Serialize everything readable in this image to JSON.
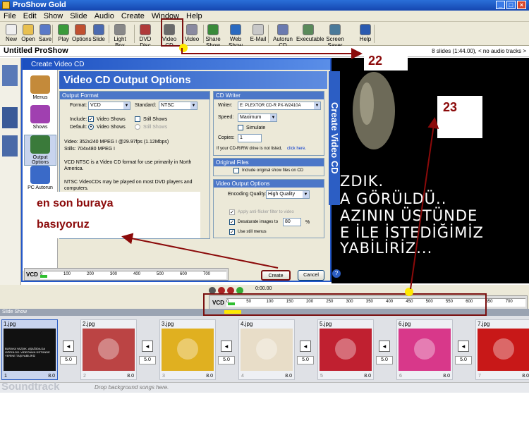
{
  "app": {
    "title": "ProShow Gold"
  },
  "menu": [
    "File",
    "Edit",
    "Show",
    "Slide",
    "Audio",
    "Create",
    "Window",
    "Help"
  ],
  "toolbar": [
    {
      "label": "New",
      "icon": "new-icon"
    },
    {
      "label": "Open",
      "icon": "open-icon"
    },
    {
      "label": "Save",
      "icon": "save-icon"
    },
    {
      "label": "Play",
      "icon": "play-icon"
    },
    {
      "label": "Options",
      "icon": "options-icon"
    },
    {
      "label": "Slide",
      "icon": "slide-icon"
    },
    {
      "label": "Light Box",
      "icon": "lightbox-icon"
    },
    {
      "label": "DVD Disc",
      "icon": "dvd-icon"
    },
    {
      "label": "Video CD",
      "icon": "videocd-icon"
    },
    {
      "label": "Video",
      "icon": "video-icon"
    },
    {
      "label": "Share Show",
      "icon": "share-icon"
    },
    {
      "label": "Web Show",
      "icon": "web-icon"
    },
    {
      "label": "E-Mail",
      "icon": "email-icon"
    },
    {
      "label": "Autorun CD",
      "icon": "autorun-icon"
    },
    {
      "label": "Executable",
      "icon": "executable-icon"
    },
    {
      "label": "Screen Saver",
      "icon": "screensaver-icon"
    },
    {
      "label": "Help",
      "icon": "help-icon"
    }
  ],
  "show": {
    "title": "Untitled ProShow",
    "info": "8 slides (1:44.00), < no audio tracks >"
  },
  "dialog": {
    "window_title": "Create Video CD",
    "header": "Video CD Output Options",
    "side_label": "Create Video CD",
    "sidebar": [
      "Menus",
      "Shows",
      "Output Options",
      "PC Autorun"
    ],
    "output_format": {
      "heading": "Output Format",
      "format_label": "Format:",
      "format_value": "VCD",
      "standard_label": "Standard:",
      "standard_value": "NTSC",
      "include_label": "Include:",
      "include_video": "Video Shows",
      "include_still": "Still Shows",
      "default_label": "Default:",
      "default_video": "Video Shows",
      "default_still": "Still Shows",
      "info_video": "Video: 352x240 MPEG I @29.97fps (1.12Mbps)",
      "info_stills": "Stills: 704x480 MPEG I",
      "desc1": "VCD NTSC is a Video CD format for use primarily in North America.",
      "desc2": "NTSC VideoCDs may be played on most DVD players and computers."
    },
    "cd_writer": {
      "heading": "CD Writer",
      "writer_label": "Writer:",
      "writer_value": "E: PLEXTOR CD-R   PX-W2410A",
      "speed_label": "Speed:",
      "speed_value": "Maximum",
      "simulate": "Simulate",
      "copies_label": "Copies:",
      "copies_value": "1",
      "note": "If your CD-R/RW drive is not listed,",
      "note_link": "click here."
    },
    "original_files": {
      "heading": "Original Files",
      "option": "Include original show files on CD"
    },
    "video_output": {
      "heading": "Video Output Options",
      "quality_label": "Encoding Quality:",
      "quality_value": "High Quality",
      "antiflicker": "Apply anti-flicker filter to video",
      "desaturate": "Desaturate images to",
      "desaturate_value": "80",
      "desaturate_unit": "%",
      "still_menus": "Use still menus"
    },
    "vcd_label": "VCD",
    "ruler_ticks": [
      "0",
      "100",
      "200",
      "300",
      "400",
      "500",
      "600",
      "700"
    ],
    "create": "Create",
    "cancel": "Cancel"
  },
  "preview_text": [
    "ZDIK.",
    "A GÖRÜLDÜ..",
    "AZININ ÜSTÜNDE",
    "E İLE İSTEDİĞİMİZ",
    "YABİLİRİZ..."
  ],
  "timeline": {
    "time": "0:00.00",
    "vcd_label": "VCD",
    "ticks": [
      "0",
      "50",
      "100",
      "150",
      "200",
      "250",
      "300",
      "350",
      "400",
      "450",
      "500",
      "550",
      "600",
      "650",
      "700"
    ]
  },
  "slideshow_label": "Slide Show",
  "slides": [
    {
      "num": "1",
      "name": "1.jpg",
      "dur": "8.0",
      "trans": "",
      "color": "#111"
    },
    {
      "num": "2",
      "name": "2.jpg",
      "dur": "8.0",
      "trans": "5.0",
      "color": "#b44"
    },
    {
      "num": "3",
      "name": "3.jpg",
      "dur": "8.0",
      "trans": "5.0",
      "color": "#e0b020"
    },
    {
      "num": "4",
      "name": "4.jpg",
      "dur": "8.0",
      "trans": "5.0",
      "color": "#e8ddc8"
    },
    {
      "num": "5",
      "name": "5.jpg",
      "dur": "8.0",
      "trans": "5.0",
      "color": "#c02030"
    },
    {
      "num": "6",
      "name": "6.jpg",
      "dur": "8.0",
      "trans": "5.0",
      "color": "#d8388a"
    },
    {
      "num": "7",
      "name": "7.jpg",
      "dur": "8.0",
      "trans": "5.0",
      "color": "#c81818"
    }
  ],
  "slide1_text": "BURAYA YAZDIK. AŞAĞIDA DA GÖRÜLDÜ. VİDEONUN ÜSTÜNDE YERİNE TAŞIYABİLİRİZ",
  "soundtrack": {
    "label": "Soundtrack",
    "hint": "Drop background songs here."
  },
  "callouts": {
    "c22": "22",
    "c23": "23",
    "note1": "en son buraya",
    "note2": "basıyoruz"
  }
}
